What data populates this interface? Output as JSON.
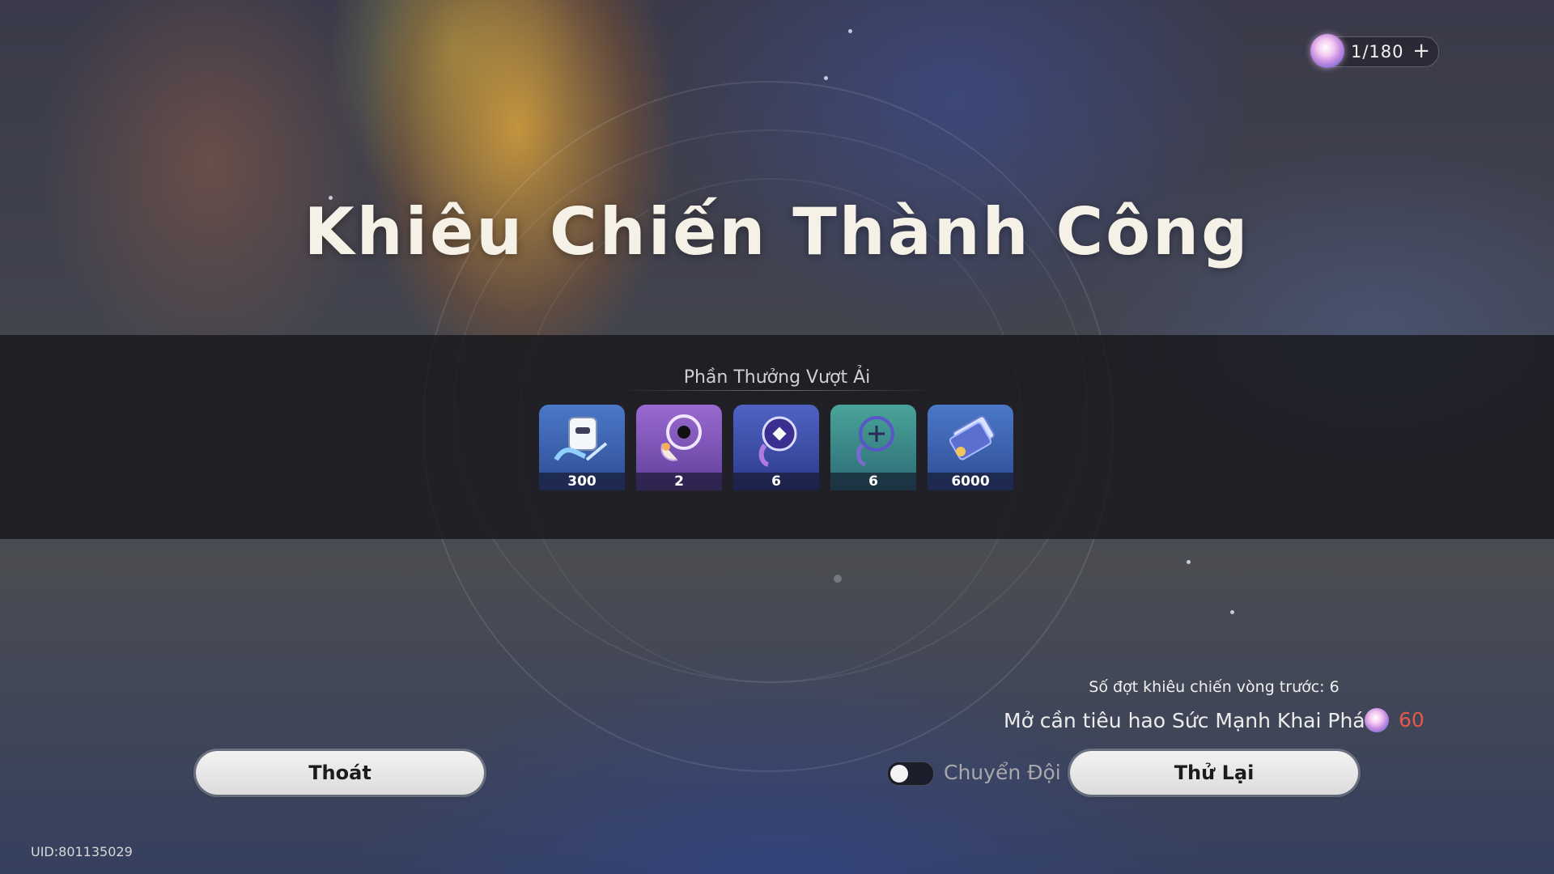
{
  "resource": {
    "icon": "trailblaze-power-orb-icon",
    "count": "1/180",
    "add_label": "+"
  },
  "title": "Khiêu Chiến Thành Công",
  "rewards": {
    "label": "Phần Thưởng Vượt Ải",
    "items": [
      {
        "icon": "traveler-guide-book-icon",
        "quantity": "300",
        "color": "#3a5fae"
      },
      {
        "icon": "purple-dreamcatcher-charm-icon",
        "quantity": "2",
        "color": "#7e4fb8"
      },
      {
        "icon": "blue-dreamcatcher-charm-icon",
        "quantity": "6",
        "color": "#3c4fa8"
      },
      {
        "icon": "green-dreamcatcher-charm-icon",
        "quantity": "6",
        "color": "#3f8f86"
      },
      {
        "icon": "credit-card-icon",
        "quantity": "6000",
        "color": "#3a5fae"
      }
    ]
  },
  "rounds_text": "Số đợt khiêu chiến vòng trước: 6",
  "cost": {
    "label": "Mở cần tiêu hao Sức Mạnh Khai Phá:",
    "icon": "trailblaze-power-orb-icon",
    "value": "60",
    "value_color": "#e35a4a"
  },
  "buttons": {
    "exit_label": "Thoát",
    "retry_label": "Thử Lại"
  },
  "toggle": {
    "label": "Chuyển Đội",
    "on": false
  },
  "uid": "UID:801135029"
}
